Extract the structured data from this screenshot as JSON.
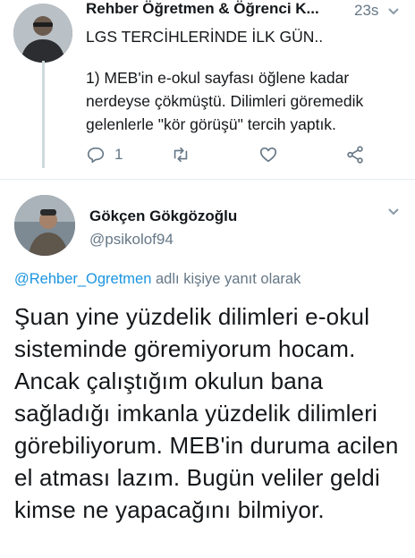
{
  "tweet1": {
    "author_name": "Rehber Öğretmen & Öğrenci K...",
    "time": "23s",
    "line1": "LGS TERCİHLERİNDE İLK GÜN..",
    "line2": "1) MEB'in e-okul sayfası öğlene kadar nerdeyse çökmüştü. Dilimleri göremedik gelenlerle \"kör görüşü\" tercih yaptık.",
    "reply_count": "1",
    "icons": [
      "reply-icon",
      "retweet-icon",
      "like-icon",
      "share-icon",
      "chevron-down-icon"
    ]
  },
  "tweet2": {
    "author_name": "Gökçen Gökgözoğlu",
    "handle": "@psikolof94",
    "replying_to_handle": "@Rehber_Ogretmen",
    "replying_to_suffix": " adlı kişiye yanıt olarak",
    "text": "Şuan yine yüzdelik dilimleri e-okul sisteminde göremiyorum hocam. Ancak çalıştığım okulun bana sağladığı imkanla yüzdelik dilimleri görebiliyorum. MEB'in duruma acilen el atması lazım. Bugün veliler geldi kimse ne yapacağını bilmiyor."
  },
  "colors": {
    "accent": "#1b95e0",
    "muted": "#657786",
    "text": "#14171a",
    "line": "#cfd9de"
  }
}
